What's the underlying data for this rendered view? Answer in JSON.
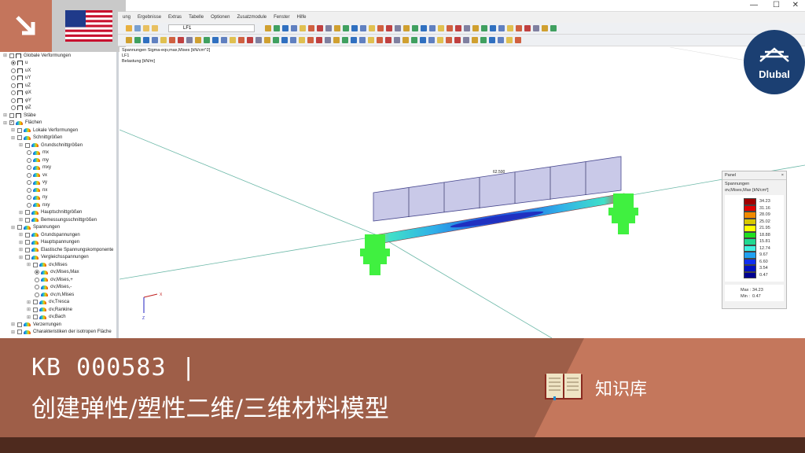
{
  "window": {
    "minimize": "—",
    "maximize": "☐",
    "close": "✕"
  },
  "menu": [
    "ung",
    "Ergebnisse",
    "Extras",
    "Tabelle",
    "Optionen",
    "Zusatzmodule",
    "Fenster",
    "Hilfe"
  ],
  "toolbar": {
    "loadcase": "LF1"
  },
  "viewport": {
    "info": [
      "Spannungen Sigma-eqv,max,Mises [kN/cm^2]",
      "LF1",
      "Belastung [kN/m]"
    ],
    "load_value": "62.500",
    "axis_x": "X",
    "axis_z": "Z"
  },
  "tree": [
    {
      "l": 0,
      "t": "cb",
      "i": "m",
      "label": "Globale Verformungen"
    },
    {
      "l": 1,
      "t": "rd",
      "on": true,
      "i": "m",
      "label": "u"
    },
    {
      "l": 1,
      "t": "rd",
      "i": "m",
      "label": "uX"
    },
    {
      "l": 1,
      "t": "rd",
      "i": "m",
      "label": "uY"
    },
    {
      "l": 1,
      "t": "rd",
      "i": "m",
      "label": "uZ"
    },
    {
      "l": 1,
      "t": "rd",
      "i": "m",
      "label": "φX"
    },
    {
      "l": 1,
      "t": "rd",
      "i": "m",
      "label": "φY"
    },
    {
      "l": 1,
      "t": "rd",
      "i": "m",
      "label": "φZ"
    },
    {
      "l": 0,
      "t": "cb",
      "i": "s",
      "label": "Stäbe"
    },
    {
      "l": 0,
      "t": "cb",
      "chk": true,
      "i": "r",
      "label": "Flächen"
    },
    {
      "l": 1,
      "t": "cb",
      "i": "r",
      "label": "Lokale Verformungen"
    },
    {
      "l": 1,
      "t": "cb",
      "i": "r",
      "label": "Schnittgrößen"
    },
    {
      "l": 2,
      "t": "cb",
      "i": "r",
      "label": "Grundschnittgrößen"
    },
    {
      "l": 3,
      "t": "rd",
      "i": "r",
      "label": "mx"
    },
    {
      "l": 3,
      "t": "rd",
      "i": "r",
      "label": "my"
    },
    {
      "l": 3,
      "t": "rd",
      "i": "r",
      "label": "mxy"
    },
    {
      "l": 3,
      "t": "rd",
      "i": "r",
      "label": "vx"
    },
    {
      "l": 3,
      "t": "rd",
      "i": "r",
      "label": "vy"
    },
    {
      "l": 3,
      "t": "rd",
      "i": "r",
      "label": "nx"
    },
    {
      "l": 3,
      "t": "rd",
      "i": "r",
      "label": "ny"
    },
    {
      "l": 3,
      "t": "rd",
      "i": "r",
      "label": "nxy"
    },
    {
      "l": 2,
      "t": "cb",
      "i": "r",
      "label": "Hauptschnittgrößen"
    },
    {
      "l": 2,
      "t": "cb",
      "i": "r",
      "label": "Bemessungsschnittgrößen"
    },
    {
      "l": 1,
      "t": "cb",
      "i": "r",
      "label": "Spannungen"
    },
    {
      "l": 2,
      "t": "cb",
      "i": "r",
      "label": "Grundspannungen"
    },
    {
      "l": 2,
      "t": "cb",
      "i": "r",
      "label": "Hauptspannungen"
    },
    {
      "l": 2,
      "t": "cb",
      "i": "r",
      "label": "Elastische Spannungskomponente"
    },
    {
      "l": 2,
      "t": "cb",
      "i": "r",
      "label": "Vergleichsspannungen"
    },
    {
      "l": 3,
      "t": "cb",
      "i": "r",
      "label": "σv,Mises"
    },
    {
      "l": 4,
      "t": "rd",
      "on": true,
      "i": "r",
      "label": "σv,Mises,Max"
    },
    {
      "l": 4,
      "t": "rd",
      "i": "r",
      "label": "σv,Mises,+"
    },
    {
      "l": 4,
      "t": "rd",
      "i": "r",
      "label": "σv,Mises,-"
    },
    {
      "l": 4,
      "t": "rd",
      "i": "r",
      "label": "σv,m,Mises"
    },
    {
      "l": 3,
      "t": "cb",
      "i": "r",
      "label": "σv,Tresca"
    },
    {
      "l": 3,
      "t": "cb",
      "i": "r",
      "label": "σv,Rankine"
    },
    {
      "l": 3,
      "t": "cb",
      "i": "r",
      "label": "σv,Bach"
    },
    {
      "l": 1,
      "t": "cb",
      "i": "r",
      "label": "Verzerrungen"
    },
    {
      "l": 1,
      "t": "cb",
      "i": "r",
      "label": "Charakteristiken der isotropen Fläche"
    }
  ],
  "panel": {
    "title": "Panel",
    "close": "×",
    "heading": "Spannungen",
    "quantity": "σv,Mises,Max [kN/cm²]",
    "legend": [
      "34.23",
      "31.16",
      "28.09",
      "25.02",
      "21.95",
      "18.88",
      "15.81",
      "12.74",
      "9.67",
      "6.60",
      "3.54",
      "0.47"
    ],
    "colors": [
      "#a00000",
      "#e00000",
      "#f08a00",
      "#d8c800",
      "#ffff00",
      "#20e020",
      "#20d890",
      "#40f0e0",
      "#20a0f0",
      "#1030f0",
      "#0010c0",
      "#000090"
    ],
    "max_label": "Max",
    "max": "34.23",
    "min_label": "Min",
    "min": "0.47"
  },
  "logo": {
    "text": "Dlubal"
  },
  "banner": {
    "kb": "KB 000583 |",
    "title": "创建弹性/塑性二维/三维材料模型",
    "category": "知识库"
  }
}
